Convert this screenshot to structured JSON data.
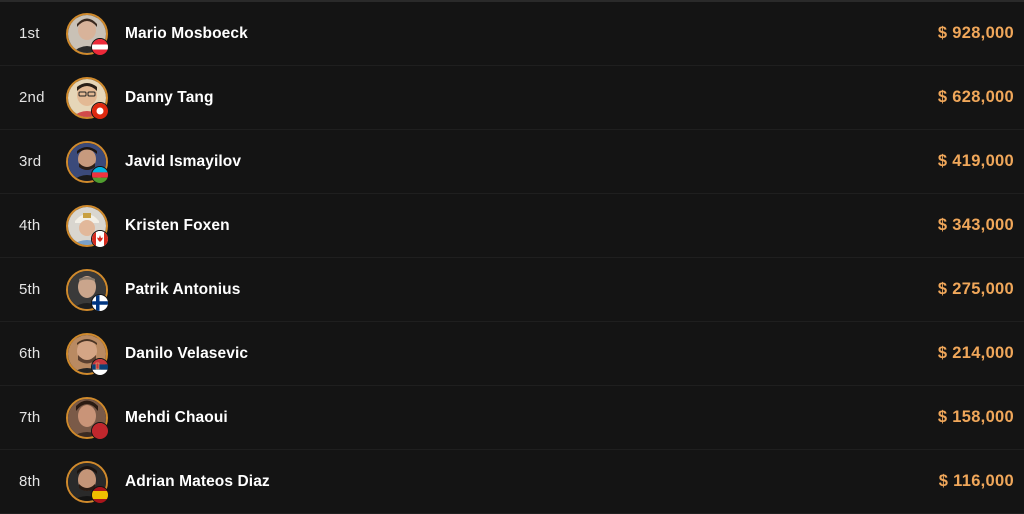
{
  "accent_color": "#f0a75a",
  "avatar_border_color": "#d08a2c",
  "results": [
    {
      "place": "1st",
      "name": "Mario Mosboeck",
      "prize": "$ 928,000",
      "flag": "austria-flag-icon"
    },
    {
      "place": "2nd",
      "name": "Danny Tang",
      "prize": "$ 628,000",
      "flag": "hong-kong-flag-icon"
    },
    {
      "place": "3rd",
      "name": "Javid Ismayilov",
      "prize": "$ 419,000",
      "flag": "azerbaijan-flag-icon"
    },
    {
      "place": "4th",
      "name": "Kristen Foxen",
      "prize": "$ 343,000",
      "flag": "canada-flag-icon"
    },
    {
      "place": "5th",
      "name": "Patrik Antonius",
      "prize": "$ 275,000",
      "flag": "finland-flag-icon"
    },
    {
      "place": "6th",
      "name": "Danilo Velasevic",
      "prize": "$ 214,000",
      "flag": "serbia-flag-icon"
    },
    {
      "place": "7th",
      "name": "Mehdi Chaoui",
      "prize": "$ 158,000",
      "flag": "morocco-flag-icon"
    },
    {
      "place": "8th",
      "name": "Adrian Mateos Diaz",
      "prize": "$ 116,000",
      "flag": "spain-flag-icon"
    }
  ]
}
